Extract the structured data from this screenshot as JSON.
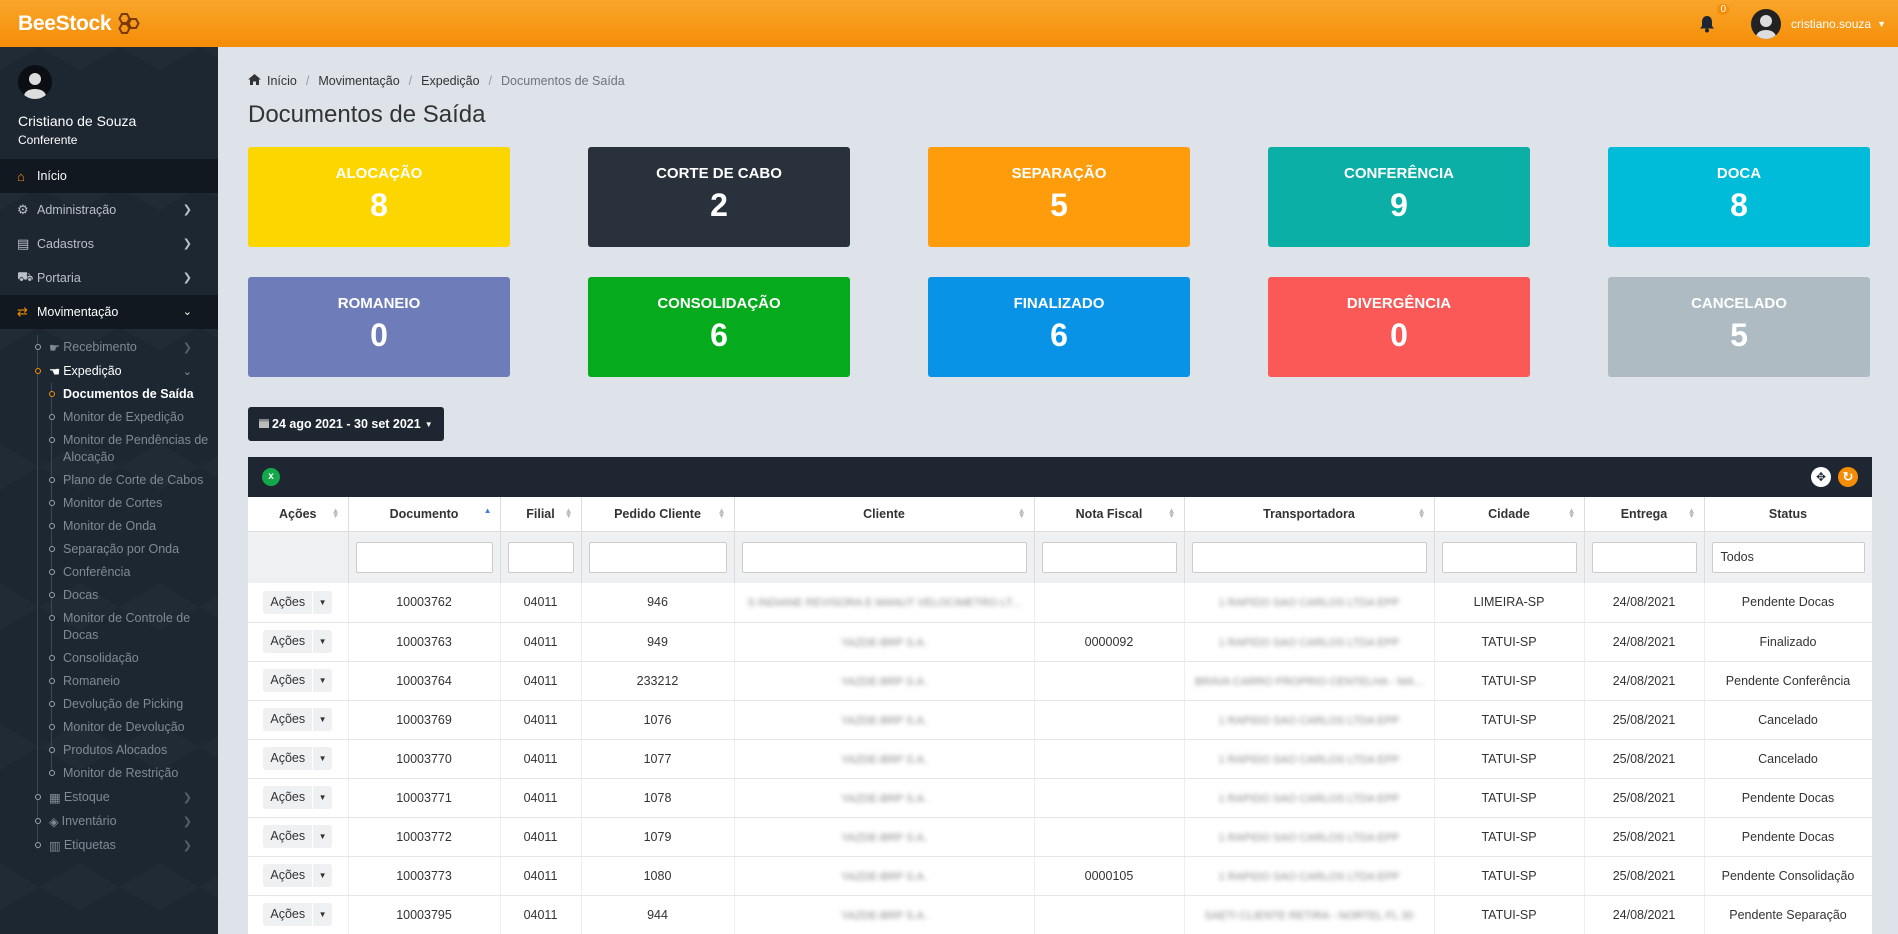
{
  "brand": {
    "part1": "Bee",
    "part2": "Stock"
  },
  "topbar": {
    "notifications": "0",
    "username": "cristiano.souza"
  },
  "profile": {
    "name": "Cristiano de Souza",
    "role": "Conferente"
  },
  "nav": {
    "home": "Início",
    "admin": "Administração",
    "cadastros": "Cadastros",
    "portaria": "Portaria",
    "movimentacao": "Movimentação",
    "recebimento": "Recebimento",
    "expedicao": "Expedição",
    "estoque": "Estoque",
    "inventario": "Inventário",
    "etiquetas": "Etiquetas",
    "expedicao_items": [
      "Documentos de Saída",
      "Monitor de Expedição",
      "Monitor de Pendências de Alocação",
      "Plano de Corte de Cabos",
      "Monitor de Cortes",
      "Monitor de Onda",
      "Separação por Onda",
      "Conferência",
      "Docas",
      "Monitor de Controle de Docas",
      "Consolidação",
      "Romaneio",
      "Devolução de Picking",
      "Monitor de Devolução",
      "Produtos Alocados",
      "Monitor de Restrição"
    ]
  },
  "breadcrumb": [
    "Início",
    "Movimentação",
    "Expedição",
    "Documentos de Saída"
  ],
  "page_title": "Documentos de Saída",
  "cards": [
    {
      "label": "ALOCAÇÃO",
      "value": "8",
      "color": "#fdd600"
    },
    {
      "label": "CORTE DE CABO",
      "value": "2",
      "color": "#29323c"
    },
    {
      "label": "SEPARAÇÃO",
      "value": "5",
      "color": "#ff9c0b"
    },
    {
      "label": "CONFERÊNCIA",
      "value": "9",
      "color": "#0bafa6"
    },
    {
      "label": "DOCA",
      "value": "8",
      "color": "#00bcd8"
    },
    {
      "label": "ROMANEIO",
      "value": "0",
      "color": "#6e7cb9"
    },
    {
      "label": "CONSOLIDAÇÃO",
      "value": "6",
      "color": "#05ab1c"
    },
    {
      "label": "FINALIZADO",
      "value": "6",
      "color": "#0893e6"
    },
    {
      "label": "DIVERGÊNCIA",
      "value": "0",
      "color": "#fb5957"
    },
    {
      "label": "CANCELADO",
      "value": "5",
      "color": "#aebbc3"
    }
  ],
  "date_range": "24 ago 2021 - 30 set 2021",
  "table": {
    "export_icon": "excel-icon",
    "columns": [
      "Ações",
      "Documento",
      "Filial",
      "Pedido Cliente",
      "Cliente",
      "Nota Fiscal",
      "Transportadora",
      "Cidade",
      "Entrega",
      "Status"
    ],
    "status_filter": "Todos",
    "action_label": "Ações",
    "rows": [
      {
        "documento": "10003762",
        "filial": "04011",
        "pedido": "946",
        "cliente": "S INDIANE REVISORA E MANUT VELOCIMETRO LT...",
        "nota": "",
        "transportadora": "1 RAPIDO SAO CARLOS LTDA EPP",
        "cidade": "LIMEIRA-SP",
        "entrega": "24/08/2021",
        "status": "Pendente Docas"
      },
      {
        "documento": "10003763",
        "filial": "04011",
        "pedido": "949",
        "cliente": "YAZDE-BRP S.A.",
        "nota": "0000092",
        "transportadora": "1 RAPIDO SAO CARLOS LTDA EPP",
        "cidade": "TATUI-SP",
        "entrega": "24/08/2021",
        "status": "Finalizado"
      },
      {
        "documento": "10003764",
        "filial": "04011",
        "pedido": "233212",
        "cliente": "YAZDE-BRP S.A.",
        "nota": "",
        "transportadora": "BRAVA CARRO PROPRIO CENTELHA - MA...",
        "cidade": "TATUI-SP",
        "entrega": "24/08/2021",
        "status": "Pendente Conferência"
      },
      {
        "documento": "10003769",
        "filial": "04011",
        "pedido": "1076",
        "cliente": "YAZDE-BRP S.A.",
        "nota": "",
        "transportadora": "1 RAPIDO SAO CARLOS LTDA EPP",
        "cidade": "TATUI-SP",
        "entrega": "25/08/2021",
        "status": "Cancelado"
      },
      {
        "documento": "10003770",
        "filial": "04011",
        "pedido": "1077",
        "cliente": "YAZDE-BRP S.A.",
        "nota": "",
        "transportadora": "1 RAPIDO SAO CARLOS LTDA EPP",
        "cidade": "TATUI-SP",
        "entrega": "25/08/2021",
        "status": "Cancelado"
      },
      {
        "documento": "10003771",
        "filial": "04011",
        "pedido": "1078",
        "cliente": "YAZDE-BRP S.A.",
        "nota": "",
        "transportadora": "1 RAPIDO SAO CARLOS LTDA EPP",
        "cidade": "TATUI-SP",
        "entrega": "25/08/2021",
        "status": "Pendente Docas"
      },
      {
        "documento": "10003772",
        "filial": "04011",
        "pedido": "1079",
        "cliente": "YAZDE-BRP S.A.",
        "nota": "",
        "transportadora": "1 RAPIDO SAO CARLOS LTDA EPP",
        "cidade": "TATUI-SP",
        "entrega": "25/08/2021",
        "status": "Pendente Docas"
      },
      {
        "documento": "10003773",
        "filial": "04011",
        "pedido": "1080",
        "cliente": "YAZDE-BRP S.A.",
        "nota": "0000105",
        "transportadora": "1 RAPIDO SAO CARLOS LTDA EPP",
        "cidade": "TATUI-SP",
        "entrega": "25/08/2021",
        "status": "Pendente Consolidação"
      },
      {
        "documento": "10003795",
        "filial": "04011",
        "pedido": "944",
        "cliente": "YAZDE-BRP S.A.",
        "nota": "",
        "transportadora": "SAETI CLIENTE RETIRA - NORTEL FL 30",
        "cidade": "TATUI-SP",
        "entrega": "24/08/2021",
        "status": "Pendente Separação"
      }
    ]
  }
}
